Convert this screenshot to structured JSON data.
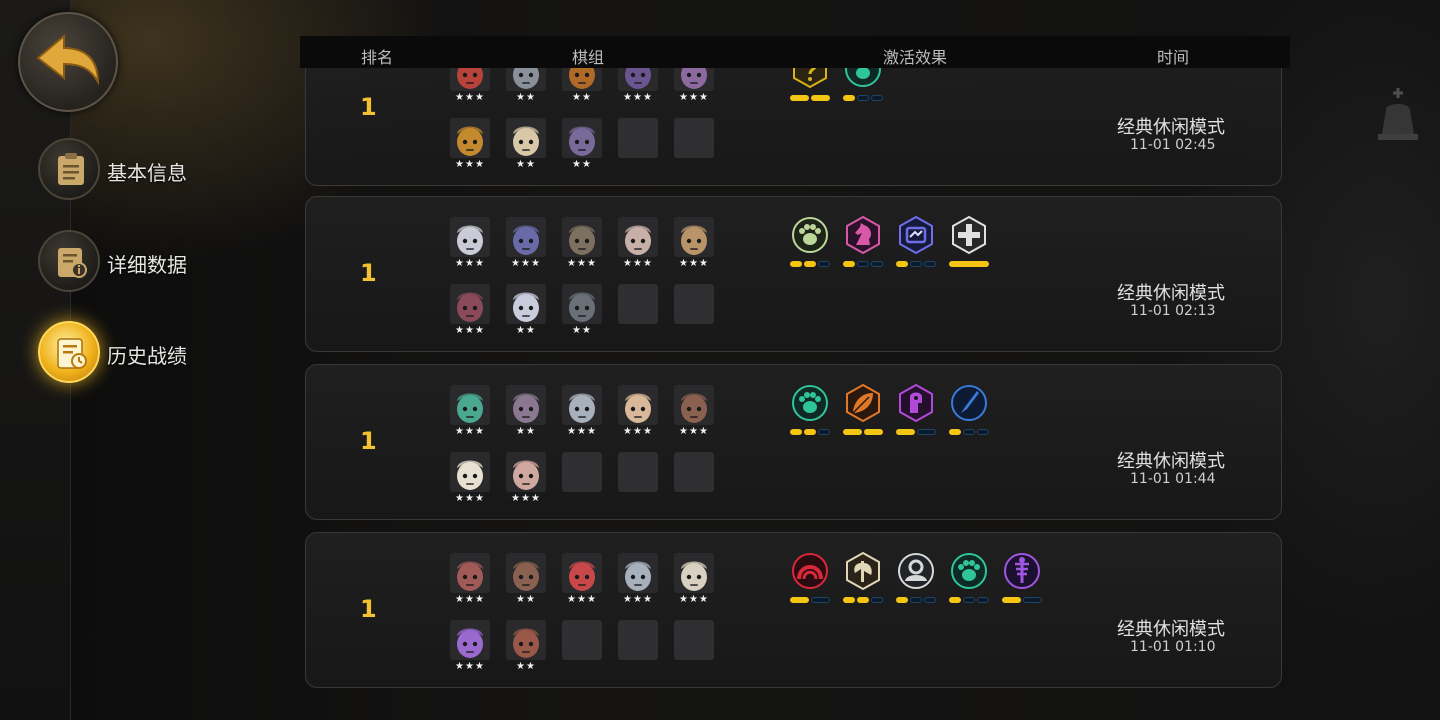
{
  "sidebar": {
    "back_icon": "back-arrow-icon",
    "items": [
      {
        "label": "基本信息",
        "icon": "clipboard-icon",
        "active": false
      },
      {
        "label": "详细数据",
        "icon": "data-info-icon",
        "active": false
      },
      {
        "label": "历史战绩",
        "icon": "history-clock-icon",
        "active": true
      }
    ]
  },
  "header": {
    "rank": "排名",
    "lineup": "棋组",
    "synergy": "激活效果",
    "time": "时间"
  },
  "matches": [
    {
      "rank": "1",
      "mode": "经典休闲模式",
      "time": "11-01 02:45",
      "heroes": [
        {
          "stars": "★★★",
          "color": "#b8433a"
        },
        {
          "stars": "★★",
          "color": "#8a9099"
        },
        {
          "stars": "★★",
          "color": "#b06a28"
        },
        {
          "stars": "★★★",
          "color": "#6a5590"
        },
        {
          "stars": "★★★",
          "color": "#8c6aa0"
        },
        {
          "stars": "★★★",
          "color": "#c28a2c"
        },
        {
          "stars": "★★",
          "color": "#d8c8a8"
        },
        {
          "stars": "★★",
          "color": "#7a6a9a"
        },
        {
          "stars": "",
          "color": ""
        },
        {
          "stars": "",
          "color": ""
        }
      ],
      "synergies": [
        {
          "icon": "question-shield-icon",
          "color": "#d9b11a",
          "bg": "#2a2410",
          "segs": [
            1,
            1
          ]
        },
        {
          "icon": "paw-icon",
          "color": "#2fc49a",
          "bg": "#0f2a24",
          "segs": [
            1,
            0,
            0
          ]
        }
      ]
    },
    {
      "rank": "1",
      "mode": "经典休闲模式",
      "time": "11-01 02:13",
      "heroes": [
        {
          "stars": "★★★",
          "color": "#c9ccd6"
        },
        {
          "stars": "★★★",
          "color": "#6a6aa8"
        },
        {
          "stars": "★★★",
          "color": "#7c7060"
        },
        {
          "stars": "★★★",
          "color": "#c8b0a8"
        },
        {
          "stars": "★★★",
          "color": "#b89468"
        },
        {
          "stars": "★★★",
          "color": "#8a4a5a"
        },
        {
          "stars": "★★",
          "color": "#c8ccdc"
        },
        {
          "stars": "★★",
          "color": "#6a7078"
        },
        {
          "stars": "",
          "color": ""
        },
        {
          "stars": "",
          "color": ""
        }
      ],
      "synergies": [
        {
          "icon": "paw-icon",
          "color": "#bcd69a",
          "bg": "#1e2418",
          "segs": [
            1,
            1,
            0
          ]
        },
        {
          "icon": "knight-icon",
          "color": "#d858a8",
          "bg": "#2a1228",
          "segs": [
            1,
            0,
            0
          ]
        },
        {
          "icon": "machine-icon",
          "color": "#6d6ee8",
          "bg": "#161a3a",
          "segs": [
            1,
            0,
            0
          ]
        },
        {
          "icon": "cross-icon",
          "color": "#e0e0e0",
          "bg": "#28282a",
          "segs": [
            1
          ]
        }
      ]
    },
    {
      "rank": "1",
      "mode": "经典休闲模式",
      "time": "11-01 01:44",
      "heroes": [
        {
          "stars": "★★★",
          "color": "#4aa890"
        },
        {
          "stars": "★★",
          "color": "#8a7890"
        },
        {
          "stars": "★★★",
          "color": "#a8b0bc"
        },
        {
          "stars": "★★★",
          "color": "#d8b898"
        },
        {
          "stars": "★★★",
          "color": "#8a6050"
        },
        {
          "stars": "★★★",
          "color": "#e8e0d0"
        },
        {
          "stars": "★★★",
          "color": "#d0a8a0"
        },
        {
          "stars": "",
          "color": ""
        },
        {
          "stars": "",
          "color": ""
        },
        {
          "stars": "",
          "color": ""
        }
      ],
      "synergies": [
        {
          "icon": "paw-icon",
          "color": "#2fc49a",
          "bg": "#0f2a24",
          "segs": [
            1,
            1,
            0
          ]
        },
        {
          "icon": "leaf-icon",
          "color": "#e0782a",
          "bg": "#2a180c",
          "segs": [
            1,
            1
          ]
        },
        {
          "icon": "demon-icon",
          "color": "#b24ad8",
          "bg": "#24102c",
          "segs": [
            1,
            0
          ]
        },
        {
          "icon": "blade-icon",
          "color": "#3a7ad8",
          "bg": "#0c1a34",
          "segs": [
            1,
            0,
            0
          ]
        }
      ]
    },
    {
      "rank": "1",
      "mode": "经典休闲模式",
      "time": "11-01 01:10",
      "heroes": [
        {
          "stars": "★★★",
          "color": "#a05a58"
        },
        {
          "stars": "★★",
          "color": "#8a6050"
        },
        {
          "stars": "★★★",
          "color": "#c8484a"
        },
        {
          "stars": "★★★",
          "color": "#a8b0bc"
        },
        {
          "stars": "★★★",
          "color": "#d8d0c0"
        },
        {
          "stars": "★★★",
          "color": "#9a6ad0"
        },
        {
          "stars": "★★",
          "color": "#9a5848"
        },
        {
          "stars": "",
          "color": ""
        },
        {
          "stars": "",
          "color": ""
        },
        {
          "stars": "",
          "color": ""
        }
      ],
      "synergies": [
        {
          "icon": "arch-icon",
          "color": "#d8283a",
          "bg": "#2a0c10",
          "segs": [
            1,
            0
          ]
        },
        {
          "icon": "axe-icon",
          "color": "#e2d6b8",
          "bg": "#2a2418",
          "segs": [
            1,
            1,
            0
          ]
        },
        {
          "icon": "head-icon",
          "color": "#d8d8d8",
          "bg": "#202428",
          "segs": [
            1,
            0,
            0
          ]
        },
        {
          "icon": "paw-icon",
          "color": "#2fc49a",
          "bg": "#0f2a24",
          "segs": [
            1,
            0,
            0
          ]
        },
        {
          "icon": "fishbone-icon",
          "color": "#a056e0",
          "bg": "#1c1030",
          "segs": [
            1,
            0
          ]
        }
      ]
    }
  ]
}
